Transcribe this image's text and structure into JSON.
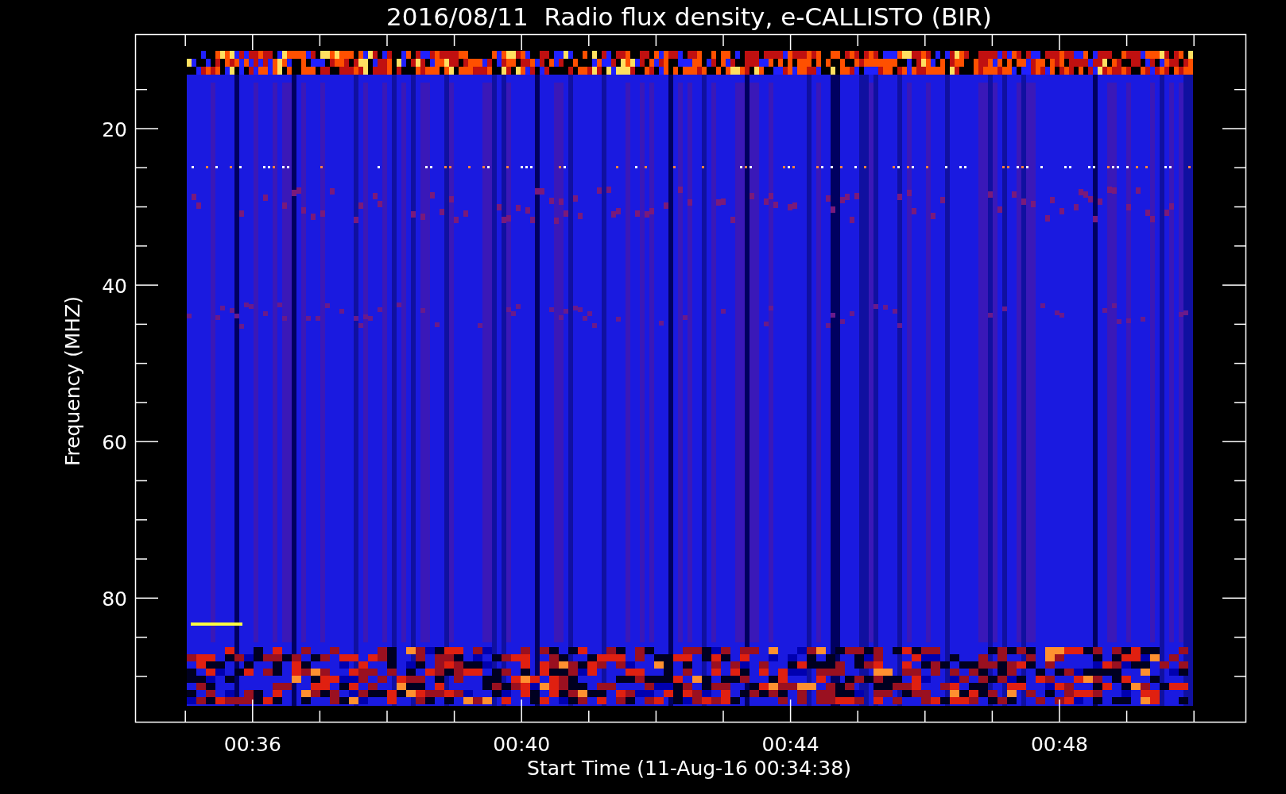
{
  "title": "2016/08/11  Radio flux density, e-CALLISTO (BIR)",
  "y_axis": {
    "label": "Frequency (MHZ)",
    "ticks": [
      "20",
      "40",
      "60",
      "80"
    ]
  },
  "x_axis": {
    "label": "Start Time (11-Aug-16 00:34:38)",
    "ticks": [
      "00:36",
      "00:40",
      "00:44",
      "00:48"
    ]
  }
}
